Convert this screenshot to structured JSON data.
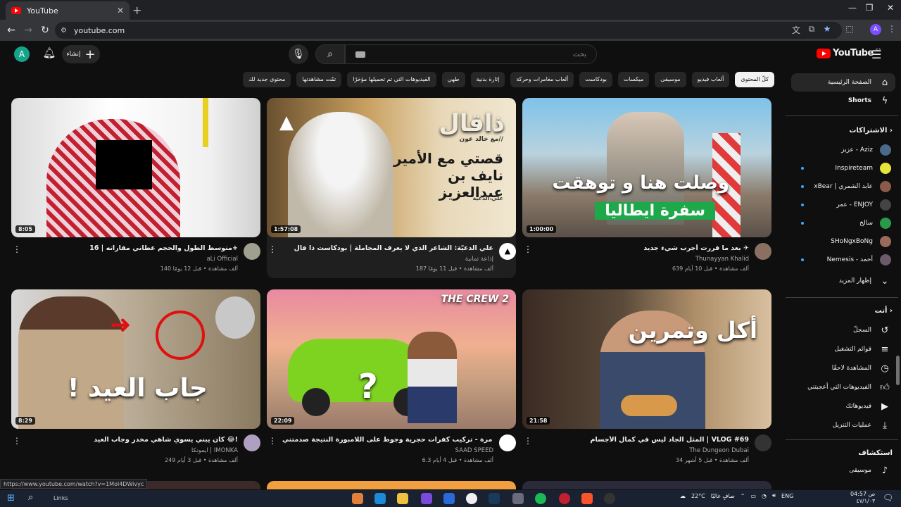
{
  "browser": {
    "tab_title": "YouTube",
    "url": "youtube.com",
    "profile_initial": "A",
    "status_url": "https://www.youtube.com/watch?v=1Mol4DWivyc"
  },
  "header": {
    "avatar_initial": "A",
    "create_label": "إنشاء",
    "search_placeholder": "بحث",
    "logo_text": "YouTube",
    "logo_country": "SA"
  },
  "chips": [
    "كلّ المحتوى",
    "ألعاب فيديو",
    "موسيقى",
    "ميكسات",
    "بودكاست",
    "ألعاب مغامرات وحركة",
    "إثارة بدنية",
    "طهي",
    "الفيديوهات التي تم تحميلها مؤخرًا",
    "تمّت مشاهدتها",
    "محتوى جديد لك"
  ],
  "sidebar": {
    "home": "الصفحة الرئيسية",
    "shorts": "Shorts",
    "subs_header": "الاشتراكات",
    "subs": [
      "عزيز - Aziz",
      "Inspireteam",
      "xBear | عابد الشمري",
      "عمر - ENJOY",
      "سالخ",
      "SHoNgxBoNg",
      "Nemesis - أحمد"
    ],
    "show_more": "إظهار المزيد",
    "you_header": "أنت",
    "you_items": [
      "السجلّ",
      "قوائم التشغيل",
      "المشاهدة لاحقًا",
      "الفيديوهات التي أعجبتني",
      "فيديوهاتك",
      "عمليات التنزيل"
    ],
    "explore_header": "استكشاف",
    "explore_items": [
      "موسيقى"
    ]
  },
  "videos": [
    {
      "title": "بعد ما قررت أجرب شيء جديد ✈︎",
      "channel": "Thunayyan Khalid",
      "stats": "639 ألف مشاهدة • قبل 10 أيام",
      "duration": "1:00:00",
      "overlay1": "وصلت هنا و توهقت",
      "overlay2": "سفرة ايطاليا"
    },
    {
      "title": "علي الدعيّة: الشاعر الذي لا يعرف المجاملة | بودكاست ذا قال",
      "channel": "إذاعة ثمانية",
      "stats": "187 ألف مشاهدة • قبل 11 يومًا",
      "duration": "1:57:08",
      "overlay1": "ذاقال",
      "overlay2": "قصتي مع الأمير نايف بن عبدالعزيز",
      "overlay3": "//مع خالد عون",
      "overlay4": "علي الدعية"
    },
    {
      "title": "متوسط الطول والحجم عطاني مقاراته | 16+",
      "channel": "aLi Official",
      "stats": "140 ألف مشاهدة • قبل 12 يومًا",
      "duration": "8:05"
    },
    {
      "title": "المثل الجاد ليس في كمال الأجسام | VLOG #69",
      "channel": "The Dungeon Dubai",
      "stats": "34 ألف مشاهدة • قبل 5 أشهر",
      "duration": "21:58",
      "overlay1": "أكل وتمرين"
    },
    {
      "title": "لأول مرة - تركيب كفرات حجرية وجوط على اللامبورة النتيجة صدمتني 🔥😍👏",
      "channel": "SAAD SPEED",
      "stats": "6.3 ألف مشاهدة • قبل 4 أيام",
      "duration": "22:09",
      "overlay1": "THE CREW 2",
      "overlay2": "?"
    },
    {
      "title": "كان يبني يسوي شاهي مخدر وجاب العيد 😂!",
      "channel": "ايمونكا | IMONKA",
      "stats": "249 ألف مشاهدة • قبل 3 أيام",
      "duration": "8:29",
      "overlay1": "جاب العيد !"
    }
  ],
  "taskbar": {
    "links": "Links",
    "weather": "22°C",
    "weather_text": "صافٍ غالبًا",
    "lang": "ENG",
    "time": "04:57 ص",
    "date": "٤٧/١/٠٣"
  },
  "colors": {
    "accent": "#ff0000",
    "bg": "#0f0f0f",
    "chip": "#272727",
    "link": "#3ea6ff"
  }
}
